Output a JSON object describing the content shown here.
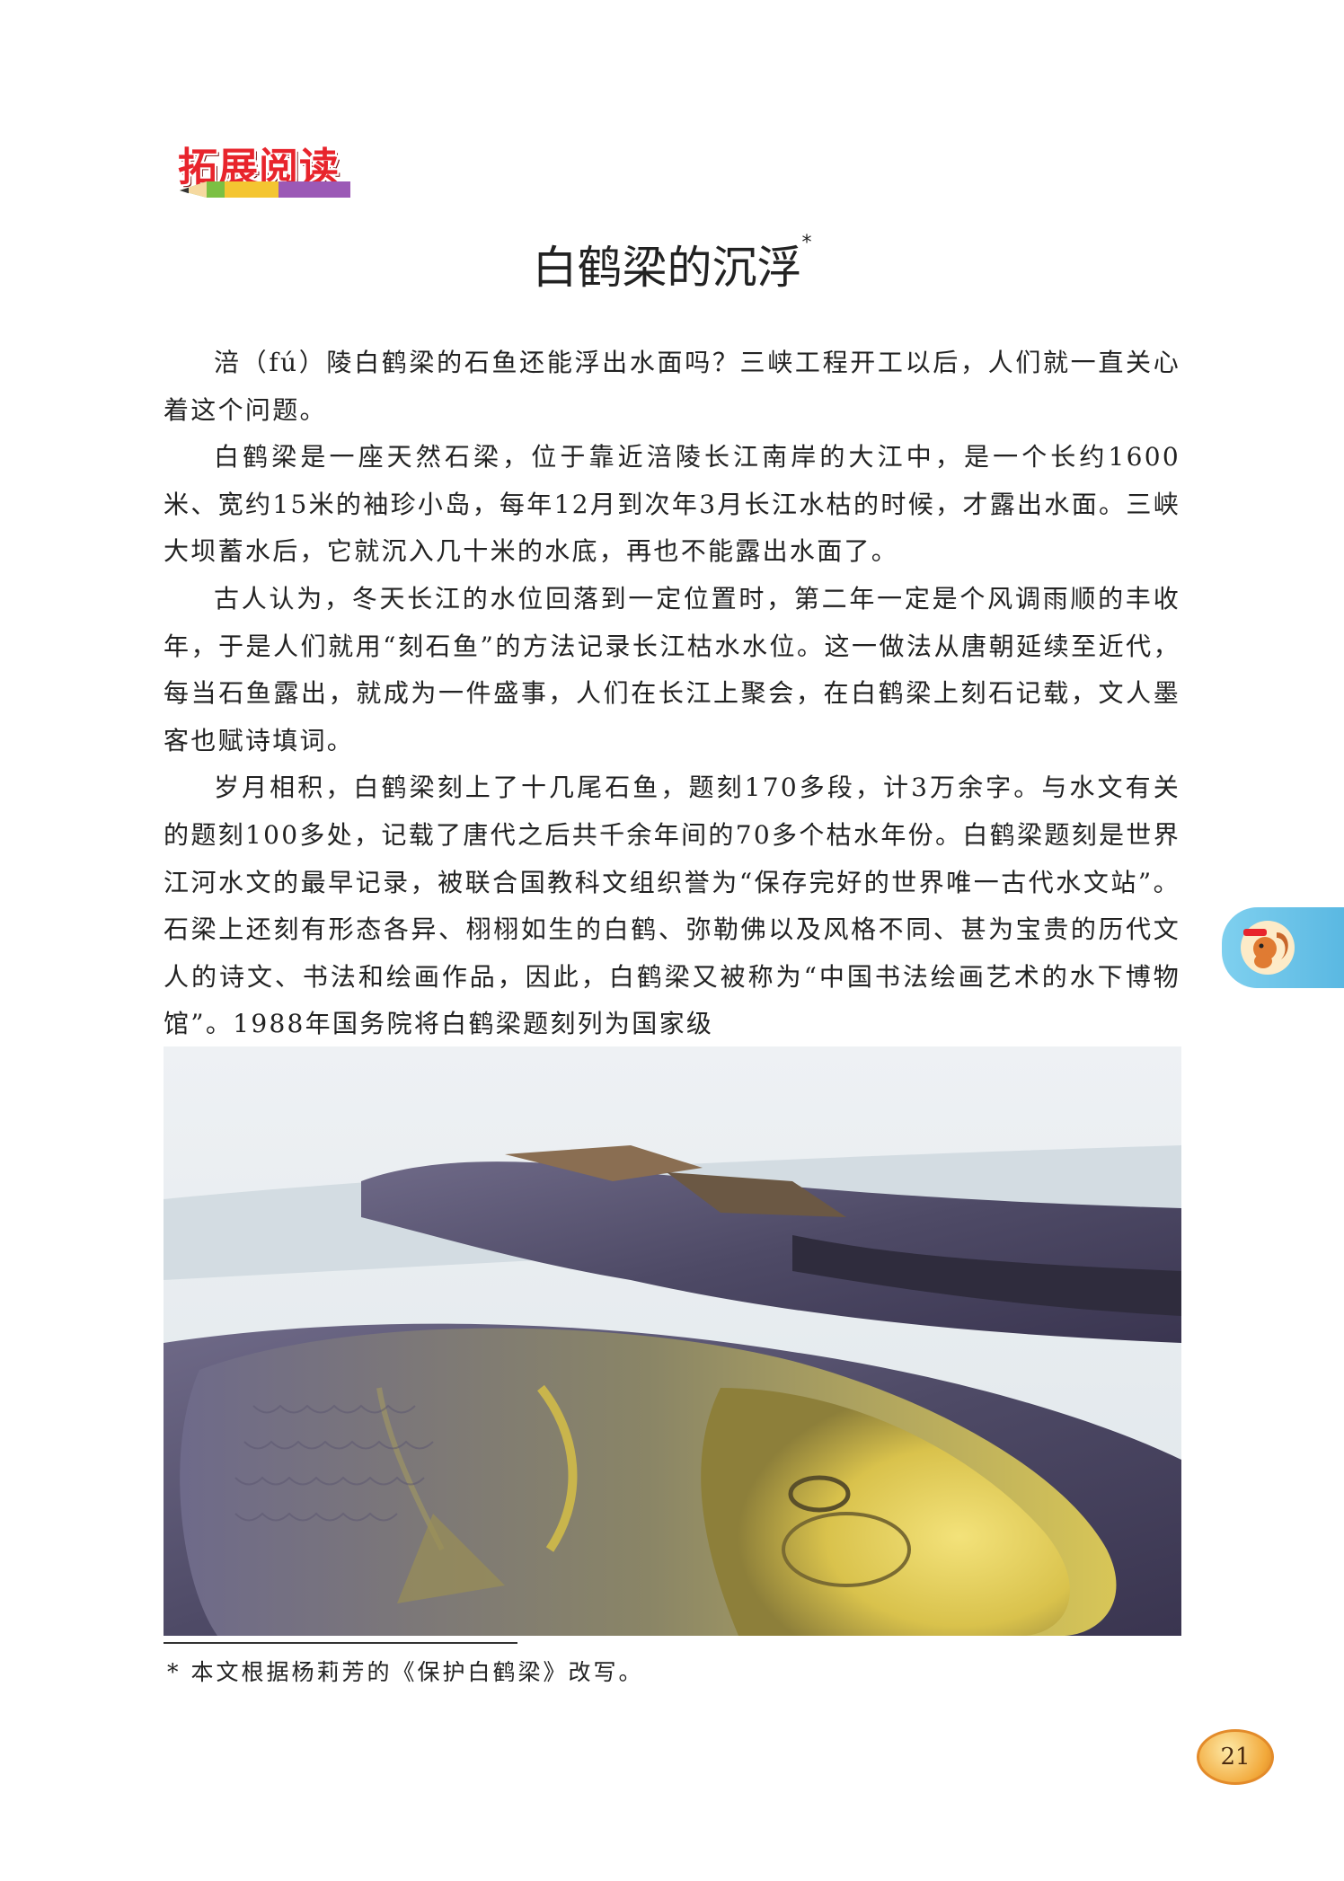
{
  "header": {
    "badge_text": "拓展阅读"
  },
  "title": {
    "text": "白鹤梁的沉浮",
    "mark": "*"
  },
  "paragraphs": [
    "涪（fú）陵白鹤梁的石鱼还能浮出水面吗？三峡工程开工以后，人们就一直关心着这个问题。",
    "白鹤梁是一座天然石梁，位于靠近涪陵长江南岸的大江中，是一个长约1600米、宽约15米的袖珍小岛，每年12月到次年3月长江水枯的时候，才露出水面。三峡大坝蓄水后，它就沉入几十米的水底，再也不能露出水面了。",
    "古人认为，冬天长江的水位回落到一定位置时，第二年一定是个风调雨顺的丰收年，于是人们就用“刻石鱼”的方法记录长江枯水水位。这一做法从唐朝延续至近代，每当石鱼露出，就成为一件盛事，人们在长江上聚会，在白鹤梁上刻石记载，文人墨客也赋诗填词。",
    "岁月相积，白鹤梁刻上了十几尾石鱼，题刻170多段，计3万余字。与水文有关的题刻100多处，记载了唐代之后共千余年间的70多个枯水年份。白鹤梁题刻是世界江河水文的最早记录，被联合国教科文组织誉为“保存完好的世界唯一古代水文站”。石梁上还刻有形态各异、栩栩如生的白鹤、弥勒佛以及风格不同、甚为宝贵的历代文人的诗文、书法和绘画作品，因此，白鹤梁又被称为“中国书法绘画艺术的水下博物馆”。1988年国务院将白鹤梁题刻列为国家级"
  ],
  "footnote": "* 本文根据杨莉芳的《保护白鹤梁》改写。",
  "page_number": "21",
  "side_tab": {
    "icon": "squirrel-mascot-icon"
  },
  "colors": {
    "badge_red": "#e8242c",
    "tab_blue": "#5ab8e2",
    "page_orange": "#f2a93b"
  }
}
